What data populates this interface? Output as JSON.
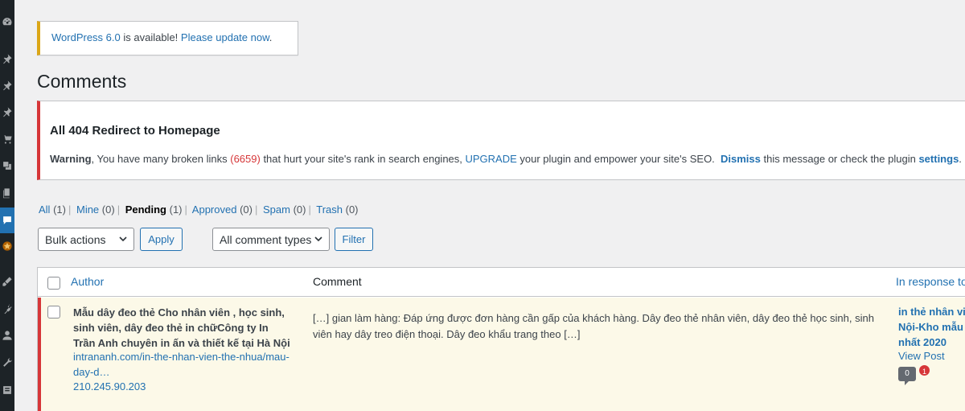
{
  "update_nag": {
    "version_link": "WordPress 6.0",
    "middle_text": " is available! ",
    "update_link": "Please update now",
    "end": "."
  },
  "page": {
    "title": "Comments"
  },
  "notice": {
    "title": "All 404 Redirect to Homepage",
    "warning_label": "Warning",
    "text1": ", You have many broken links ",
    "broken_count": "(6659)",
    "text2": " that hurt your site's rank in search engines, ",
    "upgrade": "UPGRADE",
    "text3": " your plugin and empower your site's SEO.  ",
    "dismiss": "Dismiss",
    "text4": " this message or check the plugin ",
    "settings": "settings",
    "end": "."
  },
  "filters": [
    {
      "label": "All",
      "count": "(1)",
      "current": false
    },
    {
      "label": "Mine",
      "count": "(0)",
      "current": false
    },
    {
      "label": "Pending",
      "count": "(1)",
      "current": true
    },
    {
      "label": "Approved",
      "count": "(0)",
      "current": false
    },
    {
      "label": "Spam",
      "count": "(0)",
      "current": false
    },
    {
      "label": "Trash",
      "count": "(0)",
      "current": false
    }
  ],
  "tablenav": {
    "bulk_actions": "Bulk actions",
    "apply": "Apply",
    "comment_types": "All comment types",
    "filter": "Filter"
  },
  "table": {
    "headers": {
      "author": "Author",
      "comment": "Comment",
      "response": "In response to"
    },
    "rows": [
      {
        "author_name": "Mẫu dây đeo thẻ Cho nhân viên , học sinh, sinh viên, dây đeo thẻ in chữCông ty In Trần Anh chuyên in ấn và thiết kế tại Hà Nội",
        "author_url": "intrananh.com/in-the-nhan-vien-the-nhua/mau-day-d…",
        "author_ip": "210.245.90.203",
        "comment": "[…] gian làm hàng: Đáp ứng được đơn hàng cần gấp của khách hàng. Dây đeo thẻ nhân viên, dây đeo thẻ học sinh, sinh viên hay dây treo điện thoại. Dây đeo khẩu trang theo […]",
        "response_title_l1": "in thẻ nhân viên",
        "response_title_l2": "Nội-Kho mẫu t",
        "response_title_l3": "nhất 2020",
        "view_post": "View Post",
        "approved_count": "0",
        "pending_count": "1"
      }
    ]
  },
  "colors": {
    "accent": "#2271b1",
    "error": "#d63638",
    "warning": "#dba617",
    "sidebar": "#1d2327"
  }
}
